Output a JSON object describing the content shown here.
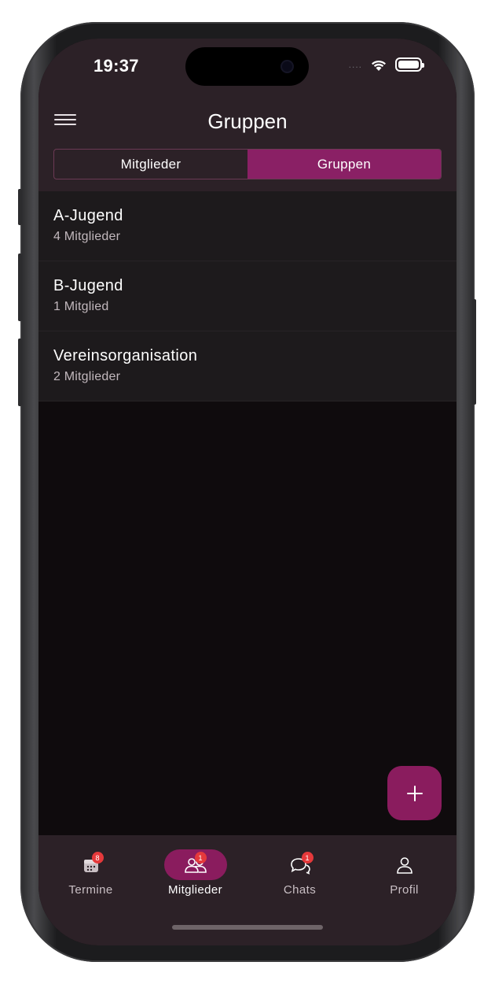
{
  "status_bar": {
    "time": "19:37",
    "signal": "....",
    "icons": [
      "wifi-icon",
      "battery-icon"
    ]
  },
  "header": {
    "title": "Gruppen",
    "menu_icon": "hamburger-menu-icon"
  },
  "segmented": {
    "tabs": [
      {
        "label": "Mitglieder",
        "active": false
      },
      {
        "label": "Gruppen",
        "active": true
      }
    ]
  },
  "groups": [
    {
      "name": "A-Jugend",
      "count": "4 Mitglieder"
    },
    {
      "name": "B-Jugend",
      "count": "1 Mitglied"
    },
    {
      "name": "Vereinsorganisation",
      "count": "2 Mitglieder"
    }
  ],
  "fab": {
    "icon": "plus-icon"
  },
  "bottom_nav": {
    "items": [
      {
        "label": "Termine",
        "icon": "calendar-icon",
        "badge": "8",
        "active": false
      },
      {
        "label": "Mitglieder",
        "icon": "people-icon",
        "badge": "1",
        "active": true
      },
      {
        "label": "Chats",
        "icon": "chat-icon",
        "badge": "1",
        "active": false
      },
      {
        "label": "Profil",
        "icon": "profile-icon",
        "badge": "",
        "active": false
      }
    ]
  },
  "colors": {
    "accent": "#8a1c5e",
    "segment_active": "#8a2065",
    "top_bar": "#2c2127",
    "list_item": "#1d1a1c",
    "background": "#0f0b0d",
    "badge": "#e5393b"
  }
}
